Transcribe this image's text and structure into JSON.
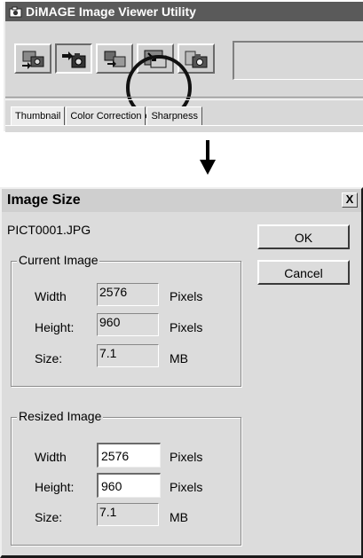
{
  "app": {
    "title": "DiMAGE Image Viewer Utility",
    "tabs": [
      {
        "label": "Thumbnail"
      },
      {
        "label": "Color Correction"
      },
      {
        "label": "Sharpness"
      }
    ]
  },
  "toolbar": {
    "buttons": [
      {
        "icon": "camera-download-icon"
      },
      {
        "icon": "camera-rotate-icon"
      },
      {
        "icon": "image-transfer-icon"
      },
      {
        "icon": "image-resize-icon"
      },
      {
        "icon": "camera-icon"
      }
    ]
  },
  "dialog": {
    "title": "Image Size",
    "close_label": "X",
    "filename": "PICT0001.JPG",
    "ok_label": "OK",
    "cancel_label": "Cancel",
    "current": {
      "legend": "Current Image",
      "width_label": "Width",
      "width_value": "2576",
      "width_unit": "Pixels",
      "height_label": "Height:",
      "height_value": "960",
      "height_unit": "Pixels",
      "size_label": "Size:",
      "size_value": "7.1",
      "size_unit": "MB"
    },
    "resized": {
      "legend": "Resized Image",
      "width_label": "Width",
      "width_value": "2576",
      "width_unit": "Pixels",
      "height_label": "Height:",
      "height_value": "960",
      "height_unit": "Pixels",
      "size_label": "Size:",
      "size_value": "7.1",
      "size_unit": "MB"
    }
  }
}
